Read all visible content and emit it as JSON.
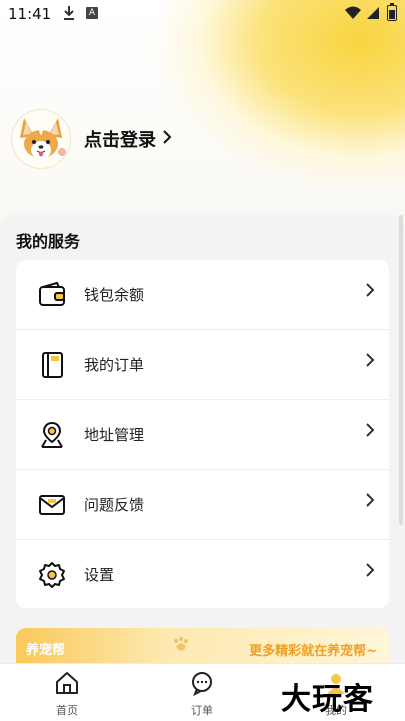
{
  "status_bar": {
    "time": "11:41"
  },
  "profile": {
    "login_text": "点击登录"
  },
  "services": {
    "title": "我的服务",
    "items": [
      {
        "label": "钱包余额",
        "icon": "wallet-icon"
      },
      {
        "label": "我的订单",
        "icon": "notebook-icon"
      },
      {
        "label": "地址管理",
        "icon": "location-pin-icon"
      },
      {
        "label": "问题反馈",
        "icon": "mail-icon"
      },
      {
        "label": "设置",
        "icon": "gear-icon"
      }
    ]
  },
  "banner": {
    "left_text": "养宠帮",
    "right_text": "更多精彩就在养宠帮~"
  },
  "tabs": [
    {
      "label": "首页",
      "icon": "home-icon"
    },
    {
      "label": "订单",
      "icon": "chat-icon"
    },
    {
      "label": "我的",
      "icon": "profile-icon"
    }
  ],
  "watermark": "大玩客",
  "colors": {
    "accent_yellow": "#f8d43f",
    "banner_text": "#f0a020"
  }
}
